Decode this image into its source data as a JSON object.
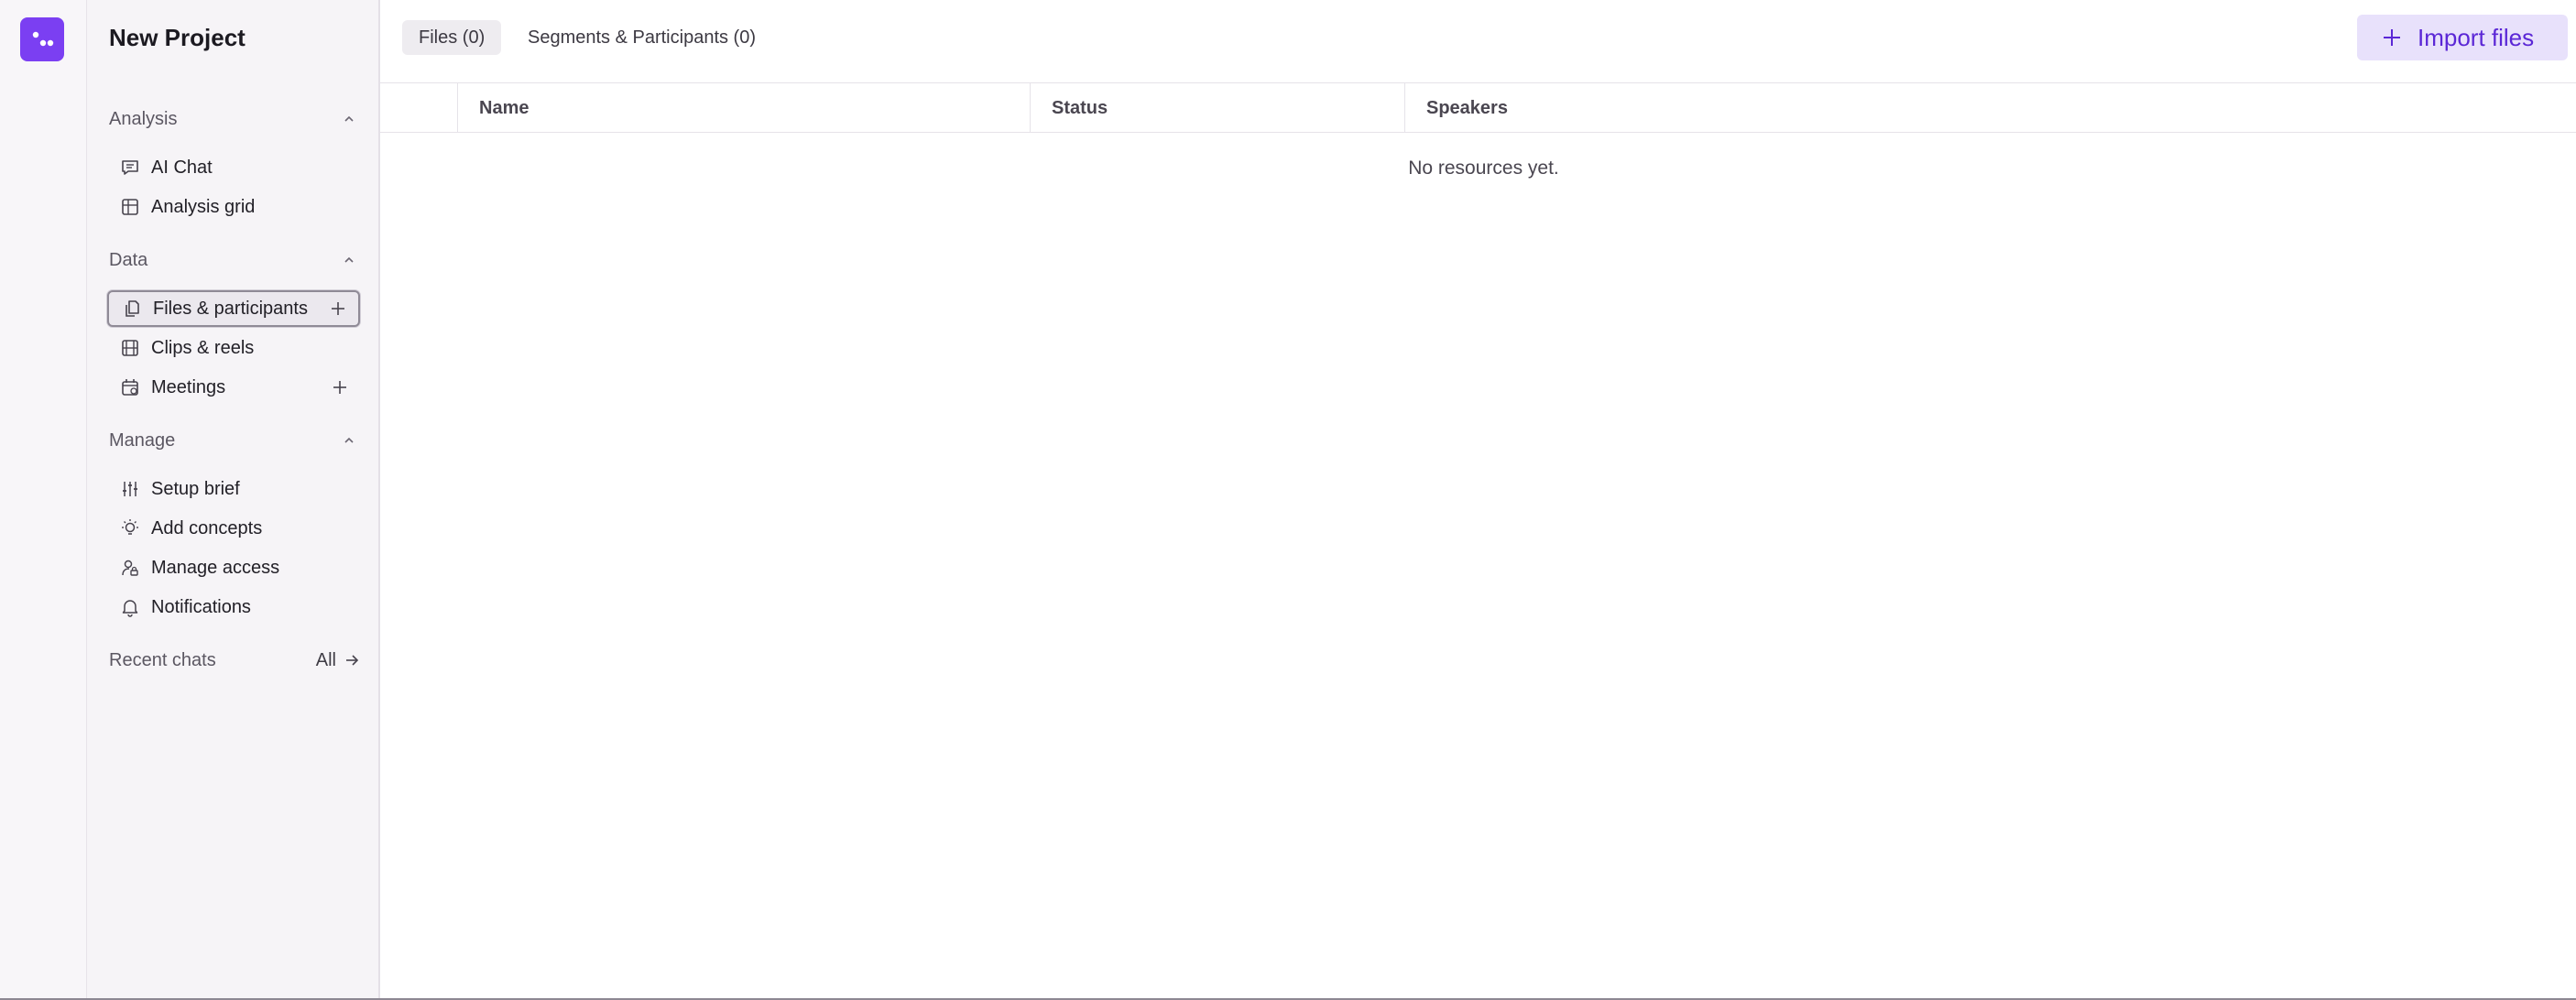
{
  "project": {
    "title": "New Project"
  },
  "sidebar": {
    "sections": [
      {
        "label": "Analysis",
        "items": [
          {
            "label": "AI Chat"
          },
          {
            "label": "Analysis grid"
          }
        ]
      },
      {
        "label": "Data",
        "items": [
          {
            "label": "Files & participants"
          },
          {
            "label": "Clips & reels"
          },
          {
            "label": "Meetings"
          }
        ]
      },
      {
        "label": "Manage",
        "items": [
          {
            "label": "Setup brief"
          },
          {
            "label": "Add concepts"
          },
          {
            "label": "Manage access"
          },
          {
            "label": "Notifications"
          }
        ]
      }
    ],
    "recent": {
      "label": "Recent chats",
      "all_label": "All"
    }
  },
  "tabs": [
    {
      "label": "Files (0)"
    },
    {
      "label": "Segments & Participants (0)"
    }
  ],
  "import_button": {
    "label": "Import files"
  },
  "table": {
    "columns": [
      {
        "label": "Name"
      },
      {
        "label": "Status"
      },
      {
        "label": "Speakers"
      }
    ],
    "empty_message": "No resources yet."
  },
  "colors": {
    "accent": "#7b3ff2",
    "import_bg": "#e8e1fb",
    "import_text": "#5b27d6"
  }
}
